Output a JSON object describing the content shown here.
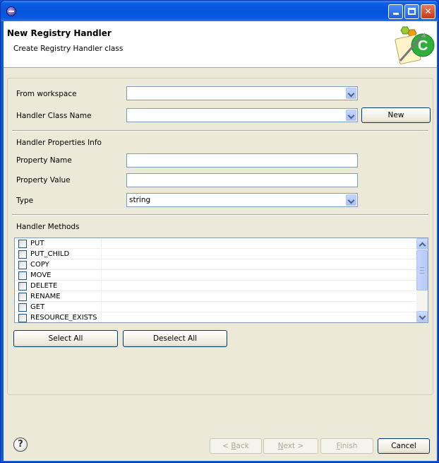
{
  "window": {
    "title": "",
    "icon": "eclipse-icon",
    "controls": [
      "minimize-icon",
      "maximize-icon",
      "close-icon"
    ]
  },
  "banner": {
    "title": "New Registry Handler",
    "description": "Create Registry Handler class",
    "logo": "wizard-logo-icon"
  },
  "form": {
    "from_workspace": {
      "label": "From workspace",
      "value": ""
    },
    "handler_class_name": {
      "label": "Handler Class Name",
      "value": "",
      "button": "New"
    },
    "properties_section": "Handler Properties Info",
    "property_name": {
      "label": "Property Name",
      "value": ""
    },
    "property_value": {
      "label": "Property Value",
      "value": ""
    },
    "type": {
      "label": "Type",
      "value": "string"
    },
    "methods_section": "Handler Methods"
  },
  "methods": [
    "PUT",
    "PUT_CHILD",
    "COPY",
    "MOVE",
    "DELETE",
    "RENAME",
    "GET",
    "RESOURCE_EXISTS"
  ],
  "method_buttons": {
    "select_all": "Select All",
    "deselect_all": "Deselect All"
  },
  "footer": {
    "help_icon": "help-icon",
    "back": {
      "prefix": "< ",
      "mnemonic": "B",
      "rest": "ack"
    },
    "next": {
      "mnemonic": "N",
      "rest": "ext >"
    },
    "finish": {
      "mnemonic": "F",
      "rest": "inish"
    },
    "cancel": "Cancel"
  },
  "colors": {
    "title_bar": "#0553dc",
    "dialog_face": "#ece9d8",
    "field_border": "#7f9db9"
  }
}
